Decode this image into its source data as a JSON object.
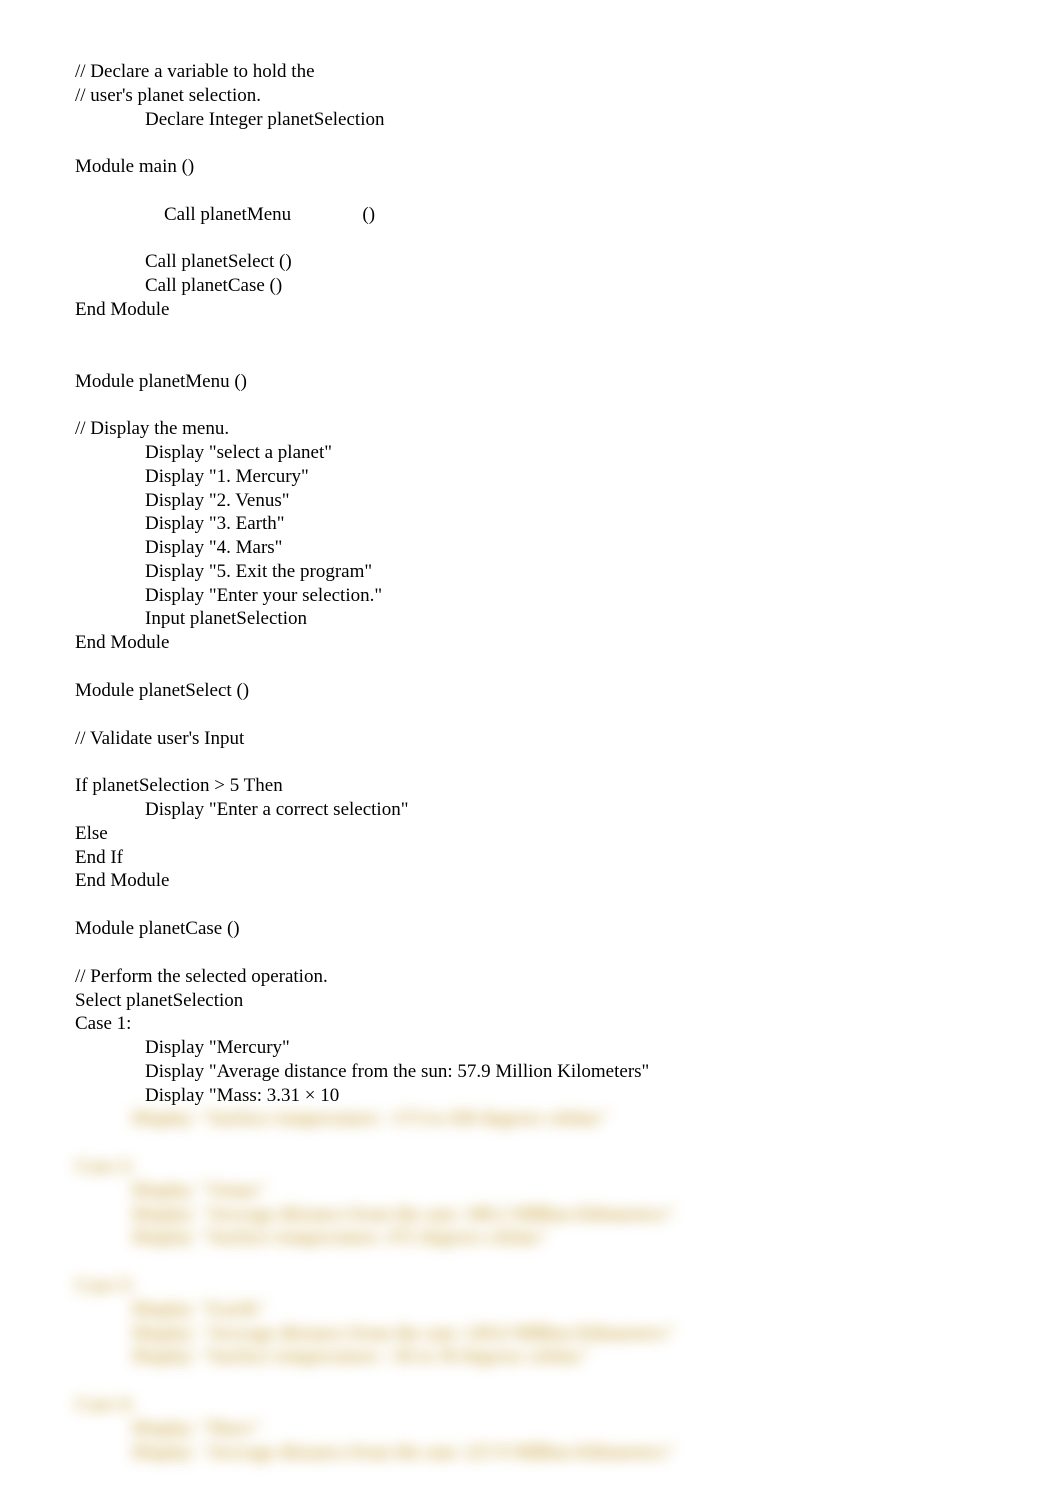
{
  "code": {
    "l1": "// Declare a variable to hold the",
    "l2": "// user's planet selection.",
    "l3": "Declare Integer planetSelection",
    "l4": "Module main ()",
    "l5a": "Call planetMenu",
    "l5b": "()",
    "l6": "Call planetSelect ()",
    "l7": "Call planetCase ()",
    "l8": "End Module",
    "l9": "Module planetMenu ()",
    "l10": "// Display the menu.",
    "l11": "Display \"select a planet\"",
    "l12": "Display \"1. Mercury\"",
    "l13": "Display \"2. Venus\"",
    "l14": "Display \"3. Earth\"",
    "l15": "Display \"4. Mars\"",
    "l16": "Display \"5. Exit the program\"",
    "l17": "Display \"Enter your selection.\"",
    "l18": "Input planetSelection",
    "l19": "End Module",
    "l20": "Module planetSelect ()",
    "l21": "// Validate user's Input",
    "l22": "If planetSelection > 5 Then",
    "l23": "Display \"Enter a correct selection\"",
    "l24": "Else",
    "l25": "End If",
    "l26": "End Module",
    "l27": "Module planetCase ()",
    "l28": "// Perform the selected operation.",
    "l29": "Select planetSelection",
    "l30": "Case 1:",
    "l31": "Display \"Mercury\"",
    "l32": "Display \"Average distance from the sun: 57.9 Million Kilometers\"",
    "l33": "Display \"Mass: 3.31 × 10"
  },
  "blurred": {
    "b1": "            Display \"Surface temperature: -173 to 430 degrees celsius\"",
    "b2": "Case 2:",
    "b3": "            Display \"Venus\"",
    "b4": "            Display \"Average distance from the sun: 108.2 Million Kilometers\"",
    "b5": "            Display \"Surface temperature: 472 degrees celsius\"",
    "b6": "Case 3:",
    "b7": "            Display \"Earth\"",
    "b8": "            Display \"Average distance from the sun: 149.6 Million Kilometers\"",
    "b9": "            Display \"Surface temperature: -50 to 50 degrees celsius\"",
    "b10": "Case 4:",
    "b11": "            Display \"Mars\"",
    "b12": "            Display \"Average distance from the sun: 227.9 Million Kilometers\""
  }
}
